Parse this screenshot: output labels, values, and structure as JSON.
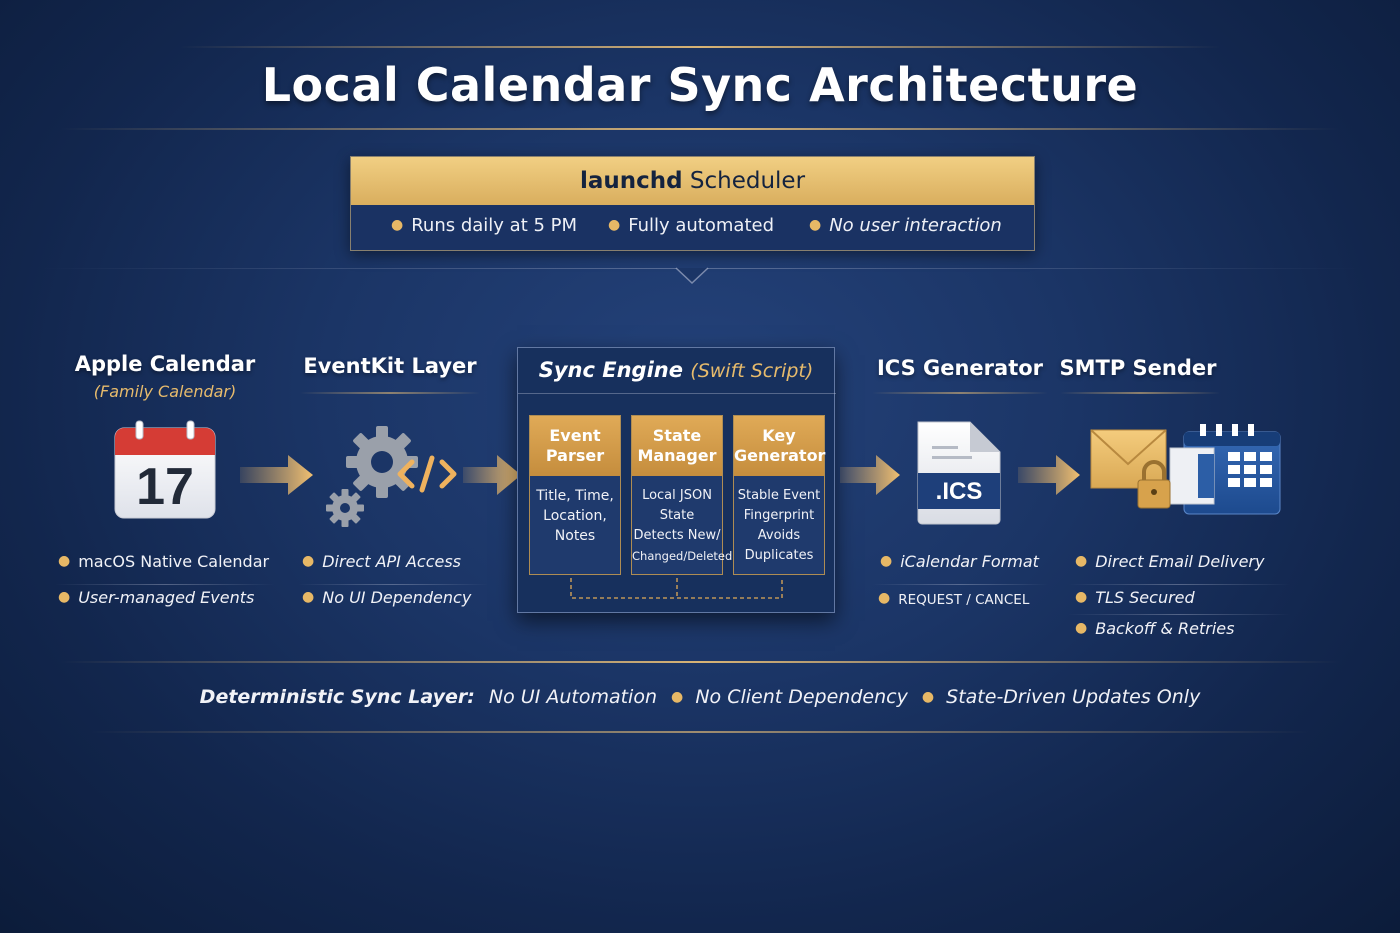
{
  "title": "Local Calendar Sync Architecture",
  "scheduler": {
    "name_bold": "launchd",
    "name_rest": "Scheduler",
    "items": [
      "Runs daily at 5 PM",
      "Fully automated",
      "No user interaction"
    ]
  },
  "stages": {
    "apple": {
      "title": "Apple Calendar",
      "subtitle": "(Family Calendar)",
      "icon": "calendar-icon",
      "day": "17",
      "bullets": [
        "macOS Native Calendar",
        "User-managed Events"
      ]
    },
    "eventkit": {
      "title": "EventKit Layer",
      "icon": "gears-code-icon",
      "bullets": [
        "Direct API Access",
        "No UI Dependency"
      ]
    },
    "engine": {
      "title": "Sync Engine",
      "subtitle": "(Swift Script)",
      "modules": [
        {
          "head": [
            "Event",
            "Parser"
          ],
          "body": [
            "Title, Time,",
            "Location,",
            "Notes"
          ]
        },
        {
          "head": [
            "State",
            "Manager"
          ],
          "body": [
            "Local JSON",
            "State",
            "Detects New/",
            "Changed/Deleted"
          ]
        },
        {
          "head": [
            "Key",
            "Generator"
          ],
          "body": [
            "Stable Event",
            "Fingerprint",
            "Avoids",
            "Duplicates"
          ]
        }
      ]
    },
    "ics": {
      "title": "ICS Generator",
      "icon": "ics-file-icon",
      "file_label": ".ICS",
      "bullets": [
        "iCalendar Format",
        "REQUEST / CANCEL"
      ]
    },
    "smtp": {
      "title": "SMTP Sender",
      "icon": "email-calendar-icon",
      "bullets": [
        "Direct Email Delivery",
        "TLS Secured",
        "Backoff & Retries"
      ]
    }
  },
  "footer": {
    "label": "Deterministic Sync Layer:",
    "items": [
      "No UI Automation",
      "No Client Dependency",
      "State-Driven Updates Only"
    ]
  },
  "colors": {
    "background": "#1b3566",
    "gold": "#e0aa57",
    "accent_text": "#e7bb6c"
  }
}
